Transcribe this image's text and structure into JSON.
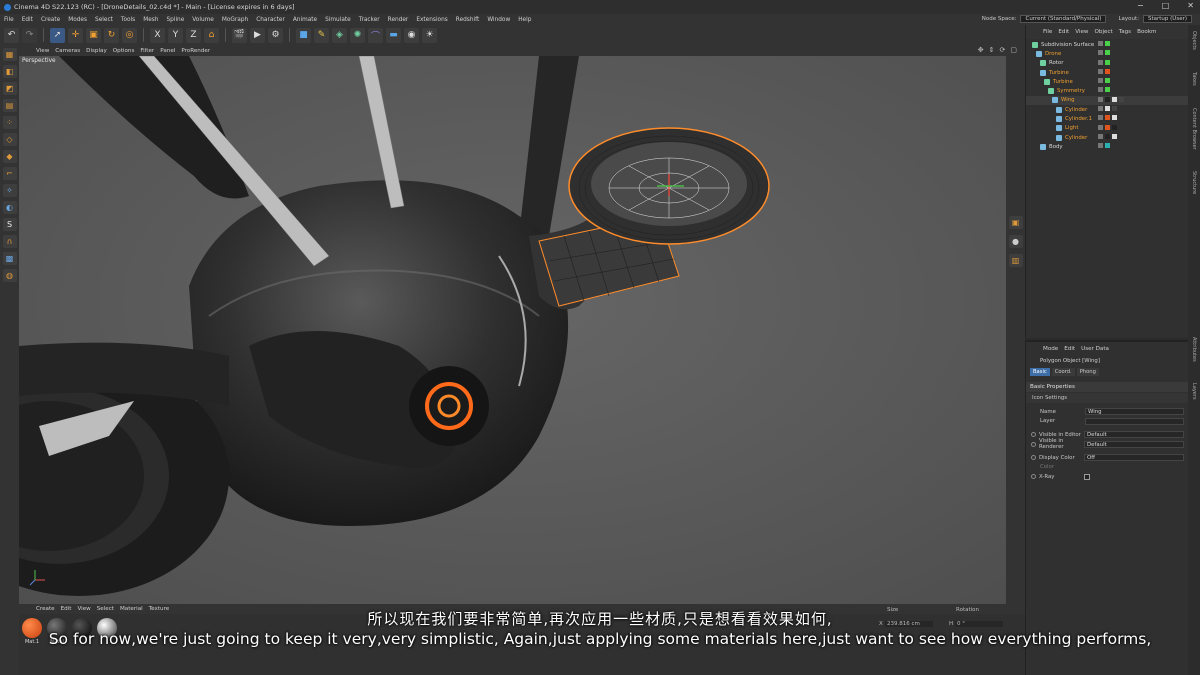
{
  "window": {
    "title": "Cinema 4D S22.123 (RC) - [DroneDetails_02.c4d *] - Main - [License expires in 6 days]",
    "controls": [
      "−",
      "□",
      "✕"
    ]
  },
  "menubar": {
    "items": [
      "File",
      "Edit",
      "Create",
      "Modes",
      "Select",
      "Tools",
      "Mesh",
      "Spline",
      "Volume",
      "MoGraph",
      "Character",
      "Animate",
      "Simulate",
      "Tracker",
      "Render",
      "Extensions",
      "Redshift",
      "Window",
      "Help"
    ],
    "node_space_label": "Node Space:",
    "node_space_value": "Current (Standard/Physical)",
    "layout_label": "Layout:",
    "layout_value": "Startup (User)"
  },
  "viewport": {
    "menu": [
      "View",
      "Cameras",
      "Display",
      "Options",
      "Filter",
      "Panel",
      "ProRender"
    ],
    "camera_label": "Perspective"
  },
  "material_manager": {
    "menu": [
      "Create",
      "Edit",
      "View",
      "Select",
      "Material",
      "Texture"
    ],
    "materials": [
      {
        "label": "Mat.1",
        "color": "#e0541e"
      },
      {
        "label": "Metal",
        "color": "#2a2a2a"
      },
      {
        "label": "",
        "color": "#151515"
      },
      {
        "label": "",
        "color": "#9a9a9a"
      }
    ]
  },
  "coordinates": {
    "size_header": "Size",
    "rotation_header": "Rotation",
    "x_label": "X",
    "x_size": "239.816 cm",
    "h_label": "H",
    "h_value": "0 °"
  },
  "object_manager": {
    "menu": [
      "File",
      "Edit",
      "View",
      "Object",
      "Tags",
      "Bookm"
    ],
    "objects": [
      {
        "name": "Subdivision Surface",
        "indent": 0,
        "orange": false
      },
      {
        "name": "Drone",
        "indent": 1,
        "orange": true
      },
      {
        "name": "Rotor",
        "indent": 2,
        "orange": false
      },
      {
        "name": "Turbine",
        "indent": 2,
        "orange": true
      },
      {
        "name": "Turbine",
        "indent": 3,
        "orange": true
      },
      {
        "name": "Symmetry",
        "indent": 4,
        "orange": true
      },
      {
        "name": "Wing",
        "indent": 5,
        "orange": true
      },
      {
        "name": "Cylinder",
        "indent": 6,
        "orange": true
      },
      {
        "name": "Cylinder.1",
        "indent": 6,
        "orange": true
      },
      {
        "name": "Light",
        "indent": 6,
        "orange": true
      },
      {
        "name": "Cylinder",
        "indent": 6,
        "orange": true
      },
      {
        "name": "Body",
        "indent": 2,
        "orange": false
      }
    ]
  },
  "attributes": {
    "menu": [
      "Mode",
      "Edit",
      "User Data"
    ],
    "object_title": "Polygon Object [Wing]",
    "tabs": [
      "Basic",
      "Coord.",
      "Phong"
    ],
    "section_title": "Basic Properties",
    "subsection": "Icon Settings",
    "fields": {
      "name_label": "Name",
      "name_value": "Wing",
      "layer_label": "Layer",
      "visible_editor_label": "Visible in Editor",
      "visible_editor_value": "Default",
      "visible_renderer_label": "Visible in Renderer",
      "visible_renderer_value": "Default",
      "display_color_label": "Display Color",
      "display_color_value": "Off",
      "color_label": "Color",
      "xray_label": "X-Ray"
    }
  },
  "side_tabs": [
    "Objects",
    "Takes",
    "Content Browser",
    "Structure",
    "Attributes",
    "Layers"
  ],
  "subtitles": {
    "zh": "所以现在我们要非常简单,再次应用一些材质,只是想看看效果如何,",
    "en": "So for now,we're just going to keep it very,very simplistic, Again,just applying some materials here,just want to see how everything performs,"
  }
}
